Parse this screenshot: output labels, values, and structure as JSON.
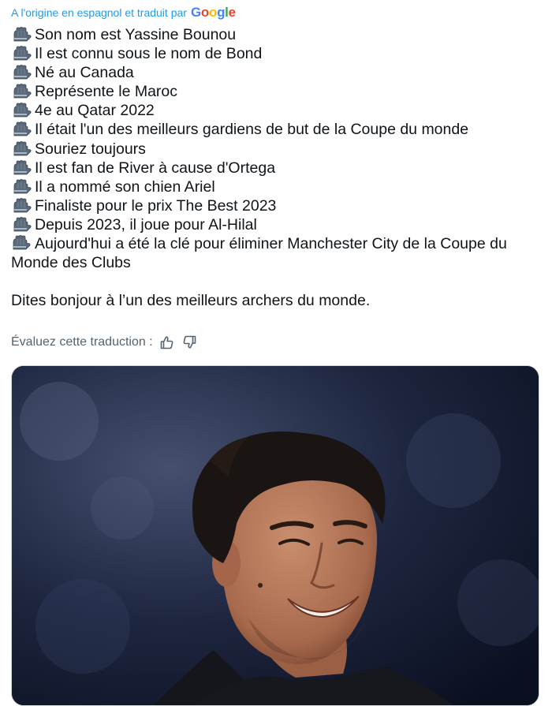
{
  "translation": {
    "label": "A l'origine en espagnol et traduit par",
    "provider": "Google",
    "provider_colors": [
      "#4285F4",
      "#EA4335",
      "#FBBC05",
      "#4285F4",
      "#34A853",
      "#EA4335"
    ]
  },
  "tweet": {
    "lines": [
      "Son nom est Yassine Bounou",
      "Il est connu sous le nom de Bond",
      "Né au Canada",
      "Représente le Maroc",
      "4e au Qatar 2022",
      "Il était l'un des meilleurs gardiens de but de la Coupe du monde",
      "Souriez toujours",
      "Il est fan de River à cause d'Ortega",
      "Il a nommé son chien Ariel",
      "Finaliste pour le prix The Best 2023",
      "Depuis 2023, il joue pour Al-Hilal",
      "Aujourd'hui a été la clé pour éliminer Manchester City de la Coupe du Monde des Clubs"
    ],
    "bullet_icon": "goalkeeper-glove-icon",
    "outro": "Dites bonjour à l’un des meilleurs archers du monde."
  },
  "rating": {
    "label": "Évaluez cette traduction :",
    "thumbs_up_icon": "thumbs-up-icon",
    "thumbs_down_icon": "thumbs-down-icon"
  },
  "colors": {
    "link": "#1d9bf0",
    "text": "#0f1419",
    "muted": "#536471"
  }
}
